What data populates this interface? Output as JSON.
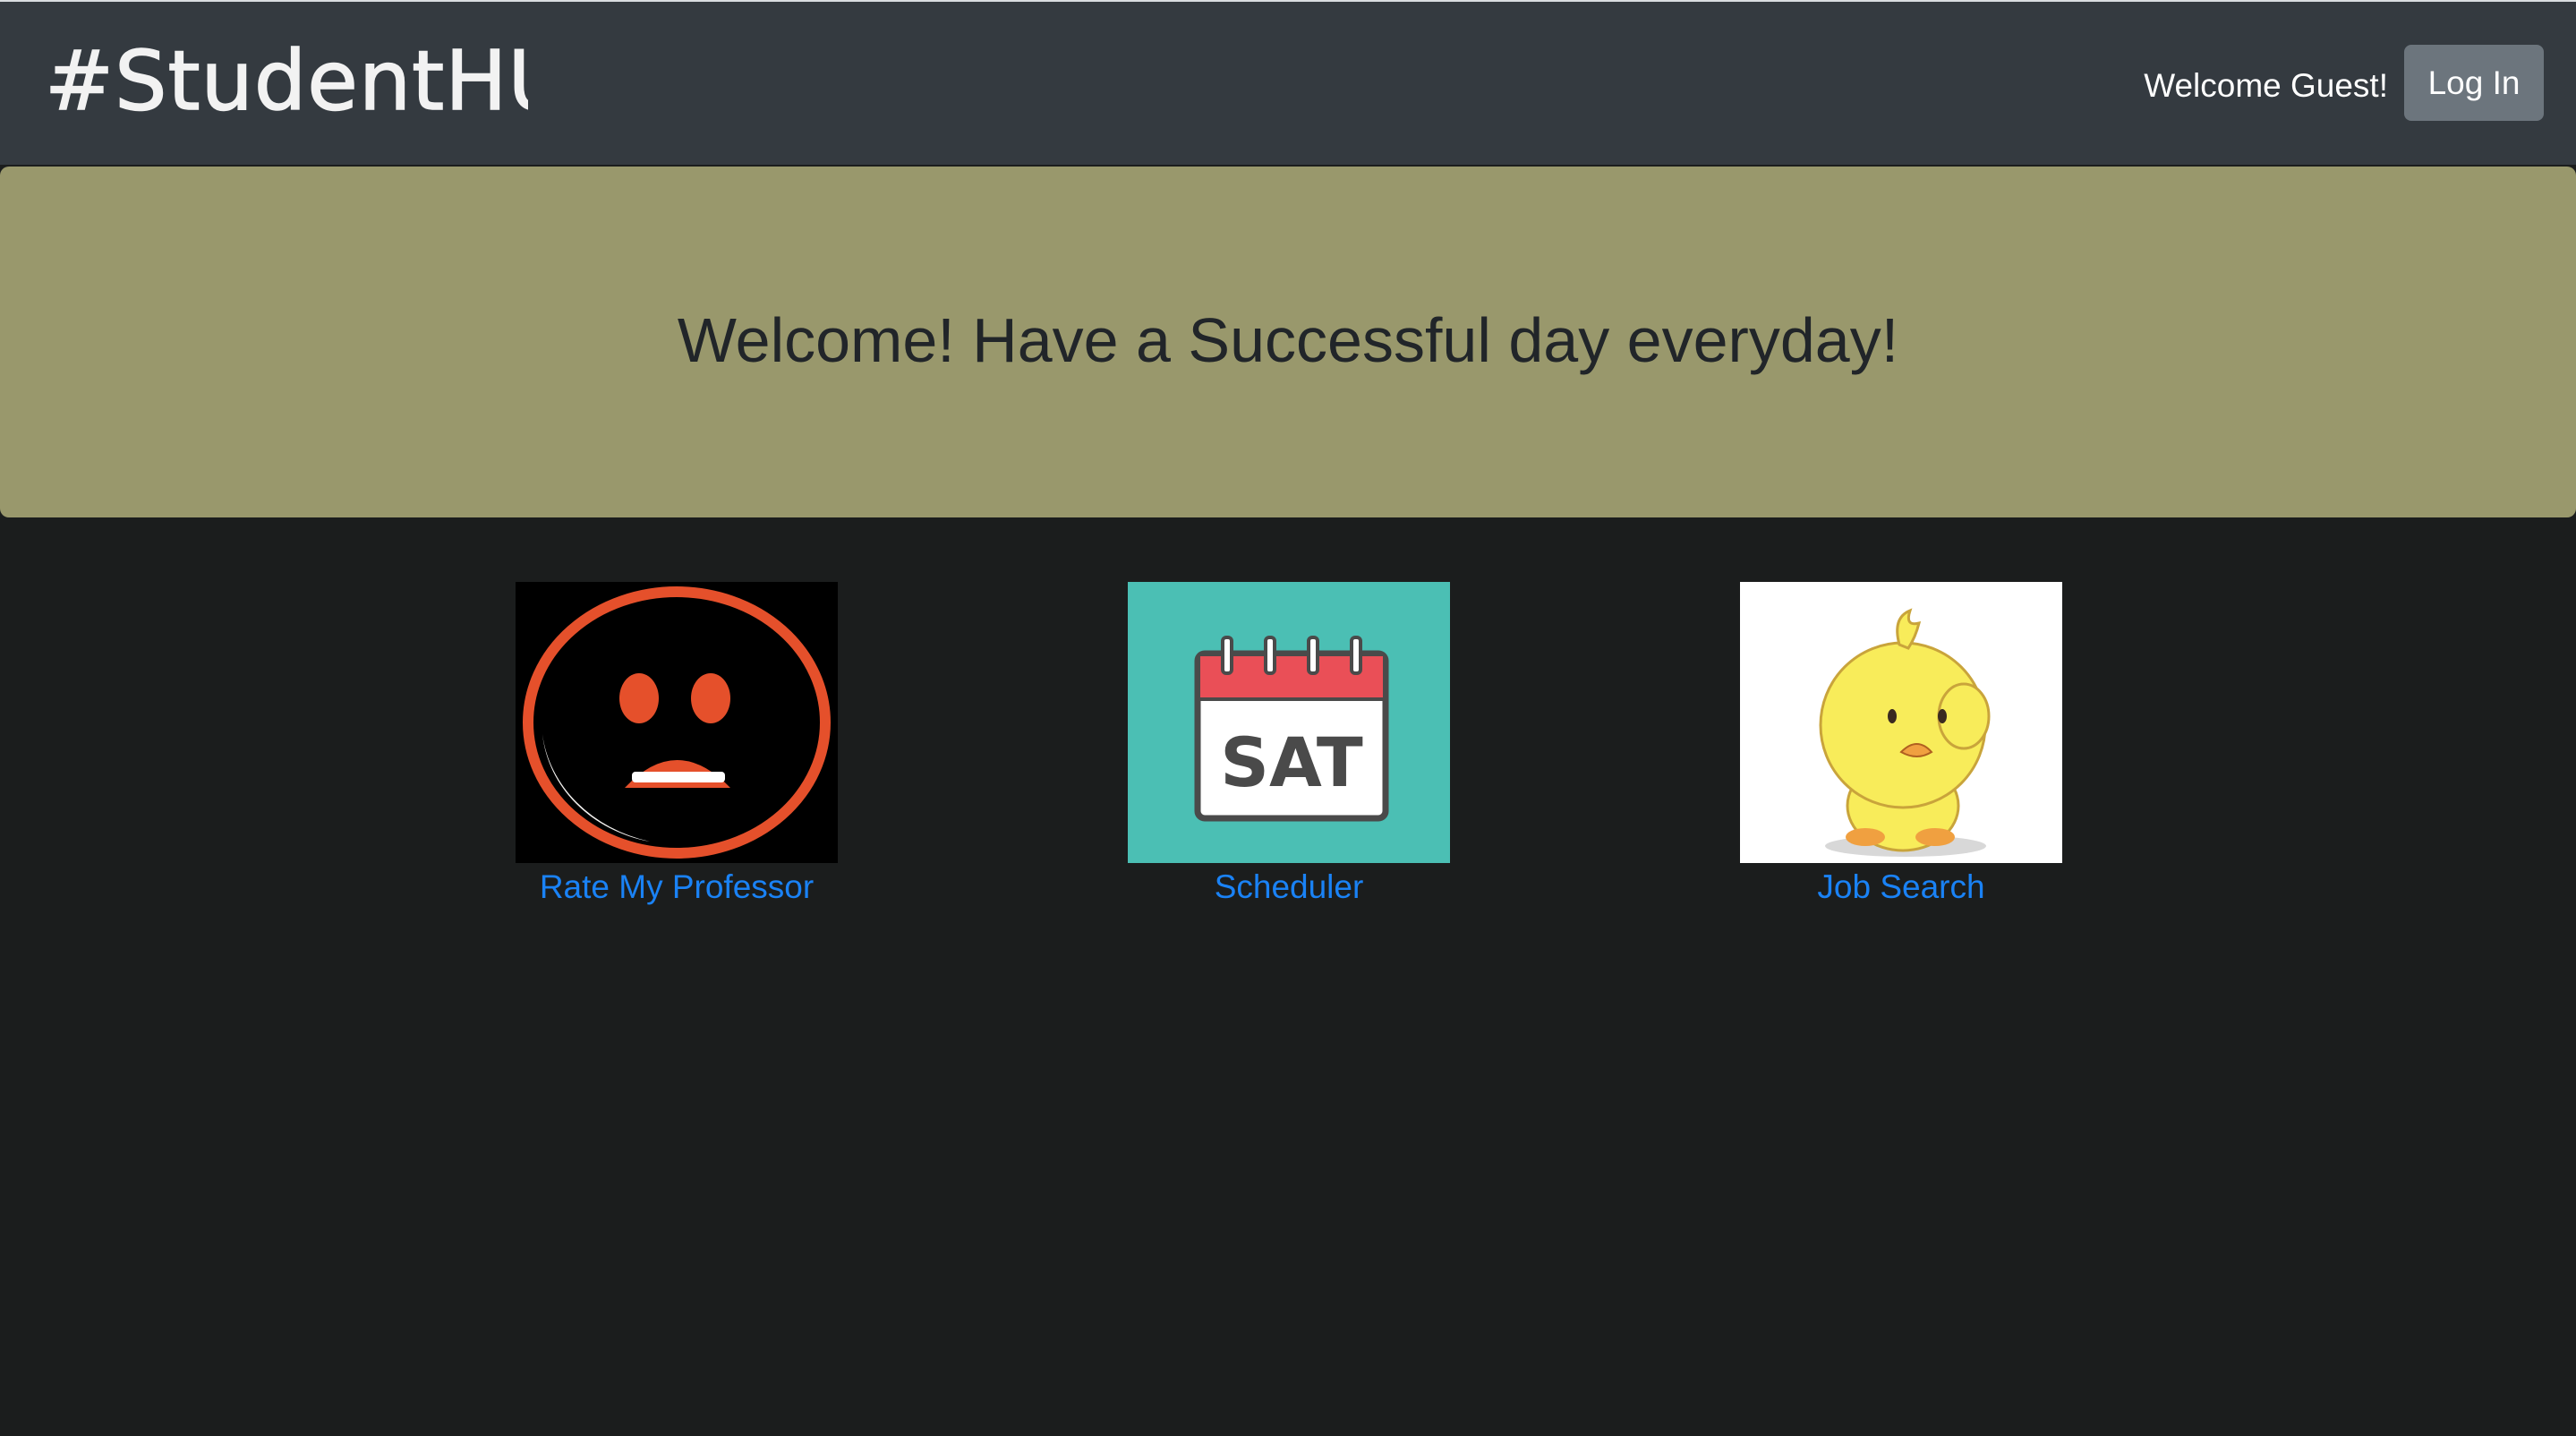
{
  "navbar": {
    "brand": "#StudentHUB",
    "welcome": "Welcome Guest!",
    "login_label": "Log In"
  },
  "hero": {
    "heading": "Welcome! Have a Successful day everyday!"
  },
  "tiles": [
    {
      "label": "Rate My Professor",
      "icon": "frowning-face-icon"
    },
    {
      "label": "Scheduler",
      "icon": "calendar-sat-icon",
      "calendar_text": "SAT"
    },
    {
      "label": "Job Search",
      "icon": "yellow-chick-icon"
    }
  ],
  "colors": {
    "navbar": "#343a40",
    "hero": "#99986c",
    "background": "#1b1d1d",
    "link": "#1a82f5",
    "button": "#6c757d"
  }
}
